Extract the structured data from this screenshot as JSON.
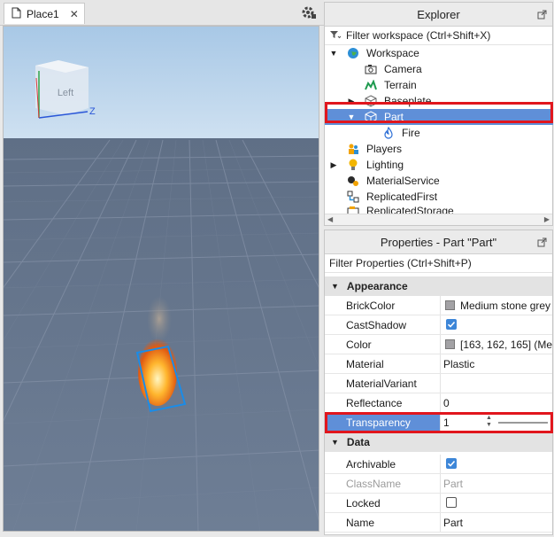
{
  "tabs": [
    {
      "label": "Place1"
    }
  ],
  "viewport": {
    "view_cube_label": "Left",
    "axis_z": "Z"
  },
  "explorer": {
    "title": "Explorer",
    "filter_placeholder": "Filter workspace (Ctrl+Shift+X)",
    "items": [
      {
        "label": "Workspace"
      },
      {
        "label": "Camera"
      },
      {
        "label": "Terrain"
      },
      {
        "label": "Baseplate"
      },
      {
        "label": "Part"
      },
      {
        "label": "Fire"
      },
      {
        "label": "Players"
      },
      {
        "label": "Lighting"
      },
      {
        "label": "MaterialService"
      },
      {
        "label": "ReplicatedFirst"
      },
      {
        "label": "ReplicatedStorage"
      }
    ]
  },
  "properties": {
    "title": "Properties - Part \"Part\"",
    "filter_placeholder": "Filter Properties (Ctrl+Shift+P)",
    "categories": [
      {
        "label": "Appearance"
      },
      {
        "label": "Data"
      }
    ],
    "rows": [
      {
        "name": "BrickColor",
        "value": "Medium stone grey",
        "swatch": "#a3a2a5"
      },
      {
        "name": "CastShadow",
        "checked": true
      },
      {
        "name": "Color",
        "value": "[163, 162, 165] (Me...",
        "swatch": "#a3a2a5"
      },
      {
        "name": "Material",
        "value": "Plastic"
      },
      {
        "name": "MaterialVariant",
        "value": ""
      },
      {
        "name": "Reflectance",
        "value": "0"
      },
      {
        "name": "Transparency",
        "value": "1"
      },
      {
        "name": "Archivable",
        "checked": true
      },
      {
        "name": "ClassName",
        "value": "Part"
      },
      {
        "name": "Locked",
        "checked": false
      },
      {
        "name": "Name",
        "value": "Part"
      }
    ]
  },
  "colors": {
    "selection": "#5f8fd8",
    "highlight": "#e1161d",
    "check": "#3d86d8"
  }
}
